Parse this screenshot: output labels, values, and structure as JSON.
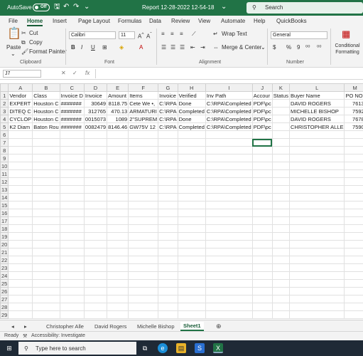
{
  "titlebar": {
    "autosave_label": "AutoSave",
    "autosave_state": "Off",
    "document_title": "Report 12-28-2022 12-54-18",
    "search_placeholder": "Search"
  },
  "menu": [
    "File",
    "Home",
    "Insert",
    "Page Layout",
    "Formulas",
    "Data",
    "Review",
    "View",
    "Automate",
    "Help",
    "QuickBooks"
  ],
  "ribbon": {
    "paste": "Paste",
    "cut": "Cut",
    "copy": "Copy",
    "format_painter": "Format Painter",
    "clipboard_group": "Clipboard",
    "font_name": "Calibri",
    "font_size": "11",
    "font_group": "Font",
    "wrap_text": "Wrap Text",
    "merge_center": "Merge & Center",
    "alignment_group": "Alignment",
    "number_format": "General",
    "number_group": "Number",
    "conditional_formatting": "Conditional Formatting",
    "bold": "B",
    "italic": "I",
    "underline": "U",
    "currency": "$",
    "percent": "%",
    "comma": "9"
  },
  "formula_bar": {
    "name_box": "J7",
    "fx": "fx",
    "formula": ""
  },
  "columns": [
    "A",
    "B",
    "C",
    "D",
    "E",
    "F",
    "G",
    "H",
    "I",
    "J",
    "K",
    "L",
    "M"
  ],
  "rows": [
    [
      "Vendor",
      "Class",
      "Invoice D",
      "Invoice",
      "Amount",
      "Items",
      "Invoice",
      "Verified",
      "Inv Path",
      "Accour",
      "Status",
      "Buyer Name",
      "PO NO."
    ],
    [
      "EXPERT",
      "Houston C",
      "#######",
      "30649",
      "8118.75",
      "Cete We •,",
      "C:\\RPA",
      "Done",
      "C:\\RPA\\Completed",
      "PDF\\pc",
      "",
      "DAVID ROGERS",
      "7613"
    ],
    [
      "DITEQ C",
      "Houston C",
      "#######",
      "312765",
      "470.13",
      "ARMATURI",
      "C:\\RPA",
      "Completed",
      "C:\\RPA\\Completed",
      "PDF\\pc",
      "",
      "MICHELLE BISHOP",
      "7592"
    ],
    [
      "CYCLOP",
      "Houston C",
      "#######",
      "0015073",
      "1089",
      "2\"SUPREM",
      "C:\\RPA",
      "Done",
      "C:\\RPA\\Completed",
      "PDF\\pc",
      "",
      "DAVID ROGERS",
      "7678"
    ],
    [
      "K2 Diam",
      "Baton Rou",
      "#######",
      "0082479",
      "8146.46",
      "GW75V 12",
      "C:\\RPA",
      "Completed",
      "C:\\RPA\\Completed",
      "PDF\\pc",
      "",
      "CHRISTOPHER ALLE",
      "7590"
    ]
  ],
  "row_numbers": [
    "1",
    "2",
    "3",
    "4",
    "5",
    "6",
    "7",
    "8",
    "9",
    "10",
    "11",
    "12",
    "13",
    "14",
    "15",
    "16",
    "17",
    "18",
    "19",
    "20",
    "21",
    "22",
    "23",
    "24",
    "25",
    "26",
    "27",
    "28",
    "29"
  ],
  "sheets": [
    "Christopher Alle",
    "David Rogers",
    "Michelle Bishop",
    "Sheet1"
  ],
  "active_sheet": "Sheet1",
  "status": {
    "ready": "Ready",
    "accessibility": "Accessibility: Investigate"
  },
  "taskbar": {
    "search_placeholder": "Type here to search"
  },
  "colors": {
    "excel_green": "#217346",
    "taskbar": "#1f2a36"
  }
}
